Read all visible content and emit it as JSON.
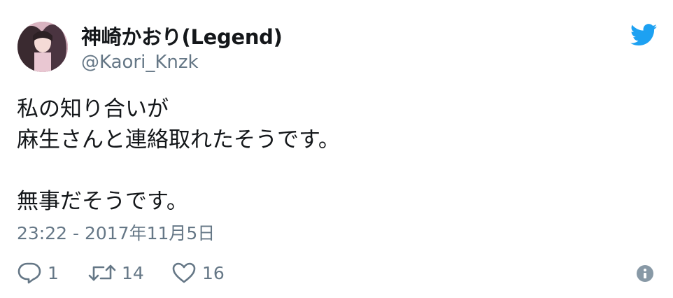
{
  "author": {
    "display_name": "神崎かおり(Legend)",
    "handle": "@Kaori_Knzk",
    "avatar_icon": "avatar-photo"
  },
  "brand": {
    "icon": "twitter-bird-icon",
    "color": "#1da1f2"
  },
  "tweet": {
    "lines": [
      "私の知り合いが",
      "麻生さんと連絡取れたそうです。",
      "",
      "無事だそうです。"
    ],
    "timestamp": "23:22 - 2017年11月5日"
  },
  "actions": {
    "reply": {
      "icon": "reply-icon",
      "count": "1"
    },
    "retweet": {
      "icon": "retweet-icon",
      "count": "14"
    },
    "like": {
      "icon": "heart-icon",
      "count": "16"
    },
    "info": {
      "icon": "info-icon"
    }
  },
  "colors": {
    "text": "#14171a",
    "muted": "#657786",
    "info": "#8899a6"
  }
}
